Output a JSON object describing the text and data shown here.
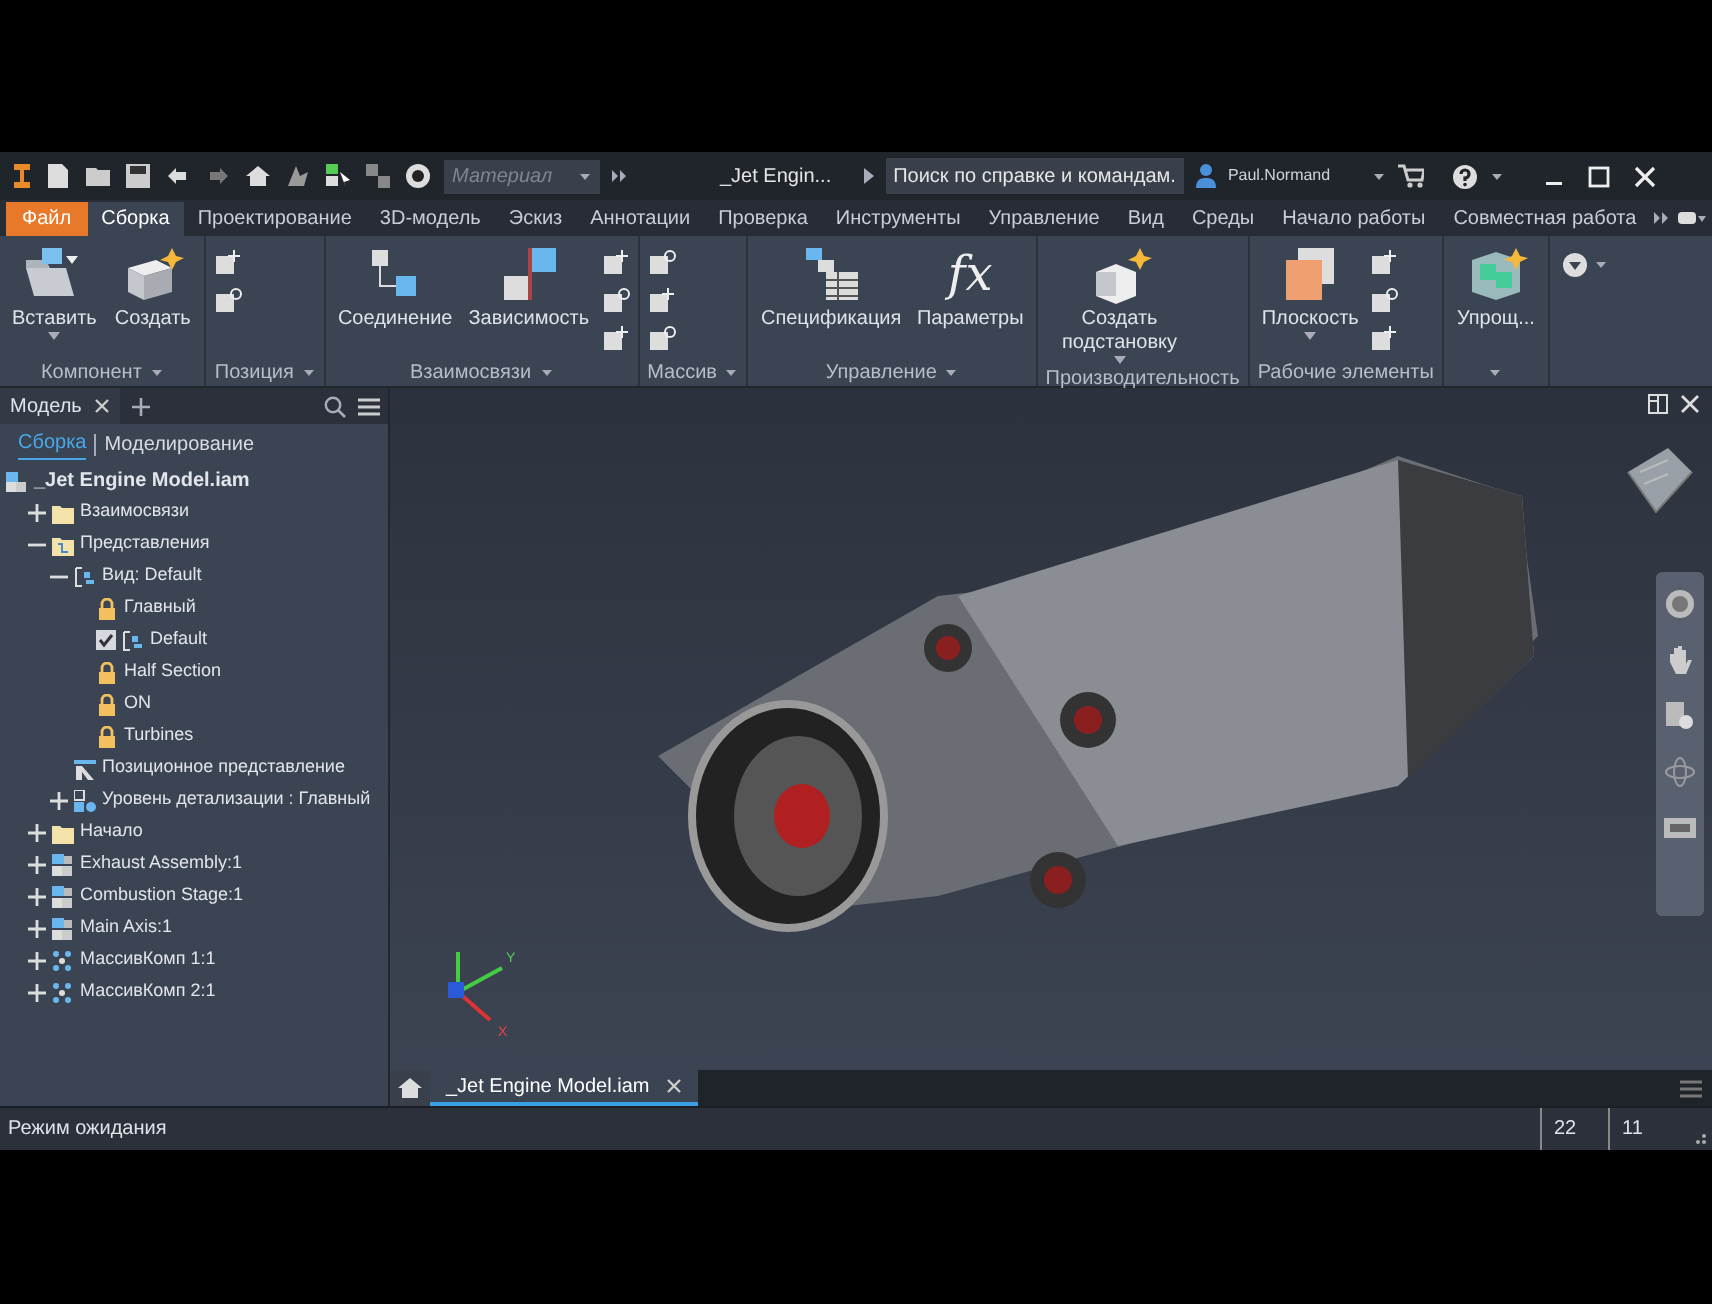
{
  "title_bar": {
    "material_placeholder": "Материал",
    "document_title": "_Jet Engin...",
    "search_placeholder": "Поиск по справке и командам.",
    "user": "Paul.Normand"
  },
  "ribbon_tabs": [
    {
      "label": "Файл",
      "kind": "file",
      "selected": false
    },
    {
      "label": "Сборка",
      "kind": "tab",
      "selected": true
    },
    {
      "label": "Проектирование",
      "kind": "tab",
      "selected": false
    },
    {
      "label": "3D-модель",
      "kind": "tab",
      "selected": false
    },
    {
      "label": "Эскиз",
      "kind": "tab",
      "selected": false
    },
    {
      "label": "Аннотации",
      "kind": "tab",
      "selected": false
    },
    {
      "label": "Проверка",
      "kind": "tab",
      "selected": false
    },
    {
      "label": "Инструменты",
      "kind": "tab",
      "selected": false
    },
    {
      "label": "Управление",
      "kind": "tab",
      "selected": false
    },
    {
      "label": "Вид",
      "kind": "tab",
      "selected": false
    },
    {
      "label": "Среды",
      "kind": "tab",
      "selected": false
    },
    {
      "label": "Начало работы",
      "kind": "tab",
      "selected": false
    },
    {
      "label": "Совместная работа",
      "kind": "tab",
      "selected": false
    }
  ],
  "ribbon_panels": [
    {
      "label": "Компонент",
      "buttons": [
        {
          "kind": "large",
          "label": "Вставить",
          "dropdown": true
        },
        {
          "kind": "large",
          "label": "Создать",
          "dropdown": false
        }
      ]
    },
    {
      "label": "Позиция",
      "buttons": [
        {
          "kind": "small"
        },
        {
          "kind": "small"
        }
      ]
    },
    {
      "label": "Взаимосвязи",
      "buttons": [
        {
          "kind": "large",
          "label": "Соединение",
          "dropdown": false
        },
        {
          "kind": "large",
          "label": "Зависимость",
          "dropdown": false
        },
        {
          "kind": "small"
        },
        {
          "kind": "small"
        },
        {
          "kind": "small"
        }
      ]
    },
    {
      "label": "Массив",
      "buttons": [
        {
          "kind": "small"
        },
        {
          "kind": "small"
        },
        {
          "kind": "small"
        }
      ]
    },
    {
      "label": "Управление",
      "buttons": [
        {
          "kind": "large",
          "label": "Спецификация",
          "dropdown": false
        },
        {
          "kind": "large",
          "label": "Параметры",
          "dropdown": false,
          "glyph": "fx"
        }
      ]
    },
    {
      "label": "Производительность",
      "buttons": [
        {
          "kind": "large",
          "label": "Создать подстановку",
          "dropdown": true
        }
      ]
    },
    {
      "label": "Рабочие элементы",
      "buttons": [
        {
          "kind": "large",
          "label": "Плоскость",
          "dropdown": true
        },
        {
          "kind": "small"
        },
        {
          "kind": "small"
        },
        {
          "kind": "small"
        }
      ]
    },
    {
      "buttons": [
        {
          "kind": "large",
          "label": "Упрощ...",
          "dropdown": false
        }
      ]
    }
  ],
  "browser": {
    "tab": "Модель",
    "subtabs": [
      {
        "label": "Сборка",
        "selected": true
      },
      {
        "label": "Моделирование",
        "selected": false
      }
    ],
    "tree": [
      {
        "label": "_Jet Engine Model.iam",
        "kind": "assembly",
        "children": [
          {
            "label": "Взаимосвязи",
            "kind": "folder",
            "expanded": false
          },
          {
            "label": "Представления",
            "kind": "rep-folder",
            "expanded": true,
            "children": [
              {
                "label": "Вид: Default",
                "kind": "view",
                "expanded": true,
                "children": [
                  {
                    "label": "Главный",
                    "kind": "locked"
                  },
                  {
                    "label": "Default",
                    "kind": "check-view",
                    "checked": true
                  },
                  {
                    "label": "Half Section",
                    "kind": "locked"
                  },
                  {
                    "label": "ON",
                    "kind": "locked"
                  },
                  {
                    "label": "Turbines",
                    "kind": "locked"
                  }
                ]
              },
              {
                "label": "Позиционное представление",
                "kind": "position"
              },
              {
                "label": "Уровень детализации : Главный",
                "kind": "detail",
                "expanded": false
              }
            ]
          },
          {
            "label": "Начало",
            "kind": "folder",
            "expanded": false
          },
          {
            "label": "Exhaust Assembly:1",
            "kind": "subassembly",
            "expanded": false
          },
          {
            "label": "Combustion Stage:1",
            "kind": "subassembly",
            "expanded": false
          },
          {
            "label": "Main Axis:1",
            "kind": "subassembly",
            "expanded": false
          },
          {
            "label": "МассивКомп 1:1",
            "kind": "pattern",
            "expanded": false
          },
          {
            "label": "МассивКомп 2:1",
            "kind": "pattern",
            "expanded": false
          }
        ]
      }
    ]
  },
  "viewport": {
    "triad_labels": [
      "Y",
      "X"
    ]
  },
  "document_tabs": [
    {
      "label": "_Jet Engine Model.iam",
      "selected": true
    }
  ],
  "status_bar": {
    "message": "Режим ожидания",
    "readouts": [
      "22",
      "11"
    ]
  }
}
